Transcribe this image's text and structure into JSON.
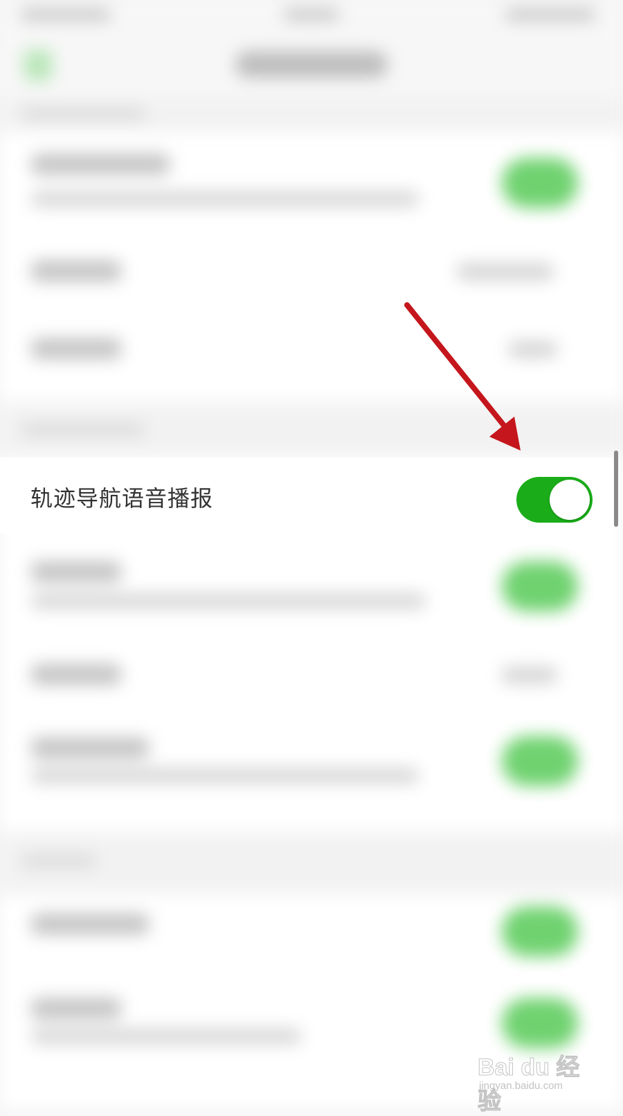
{
  "setting": {
    "label": "轨迹导航语音播报",
    "enabled": true,
    "accent_color": "#1aad19"
  },
  "annotation": {
    "type": "arrow",
    "color": "#c4161c"
  },
  "watermark": {
    "brand": "Bai du 经验",
    "site": "jingyan.baidu.com"
  }
}
